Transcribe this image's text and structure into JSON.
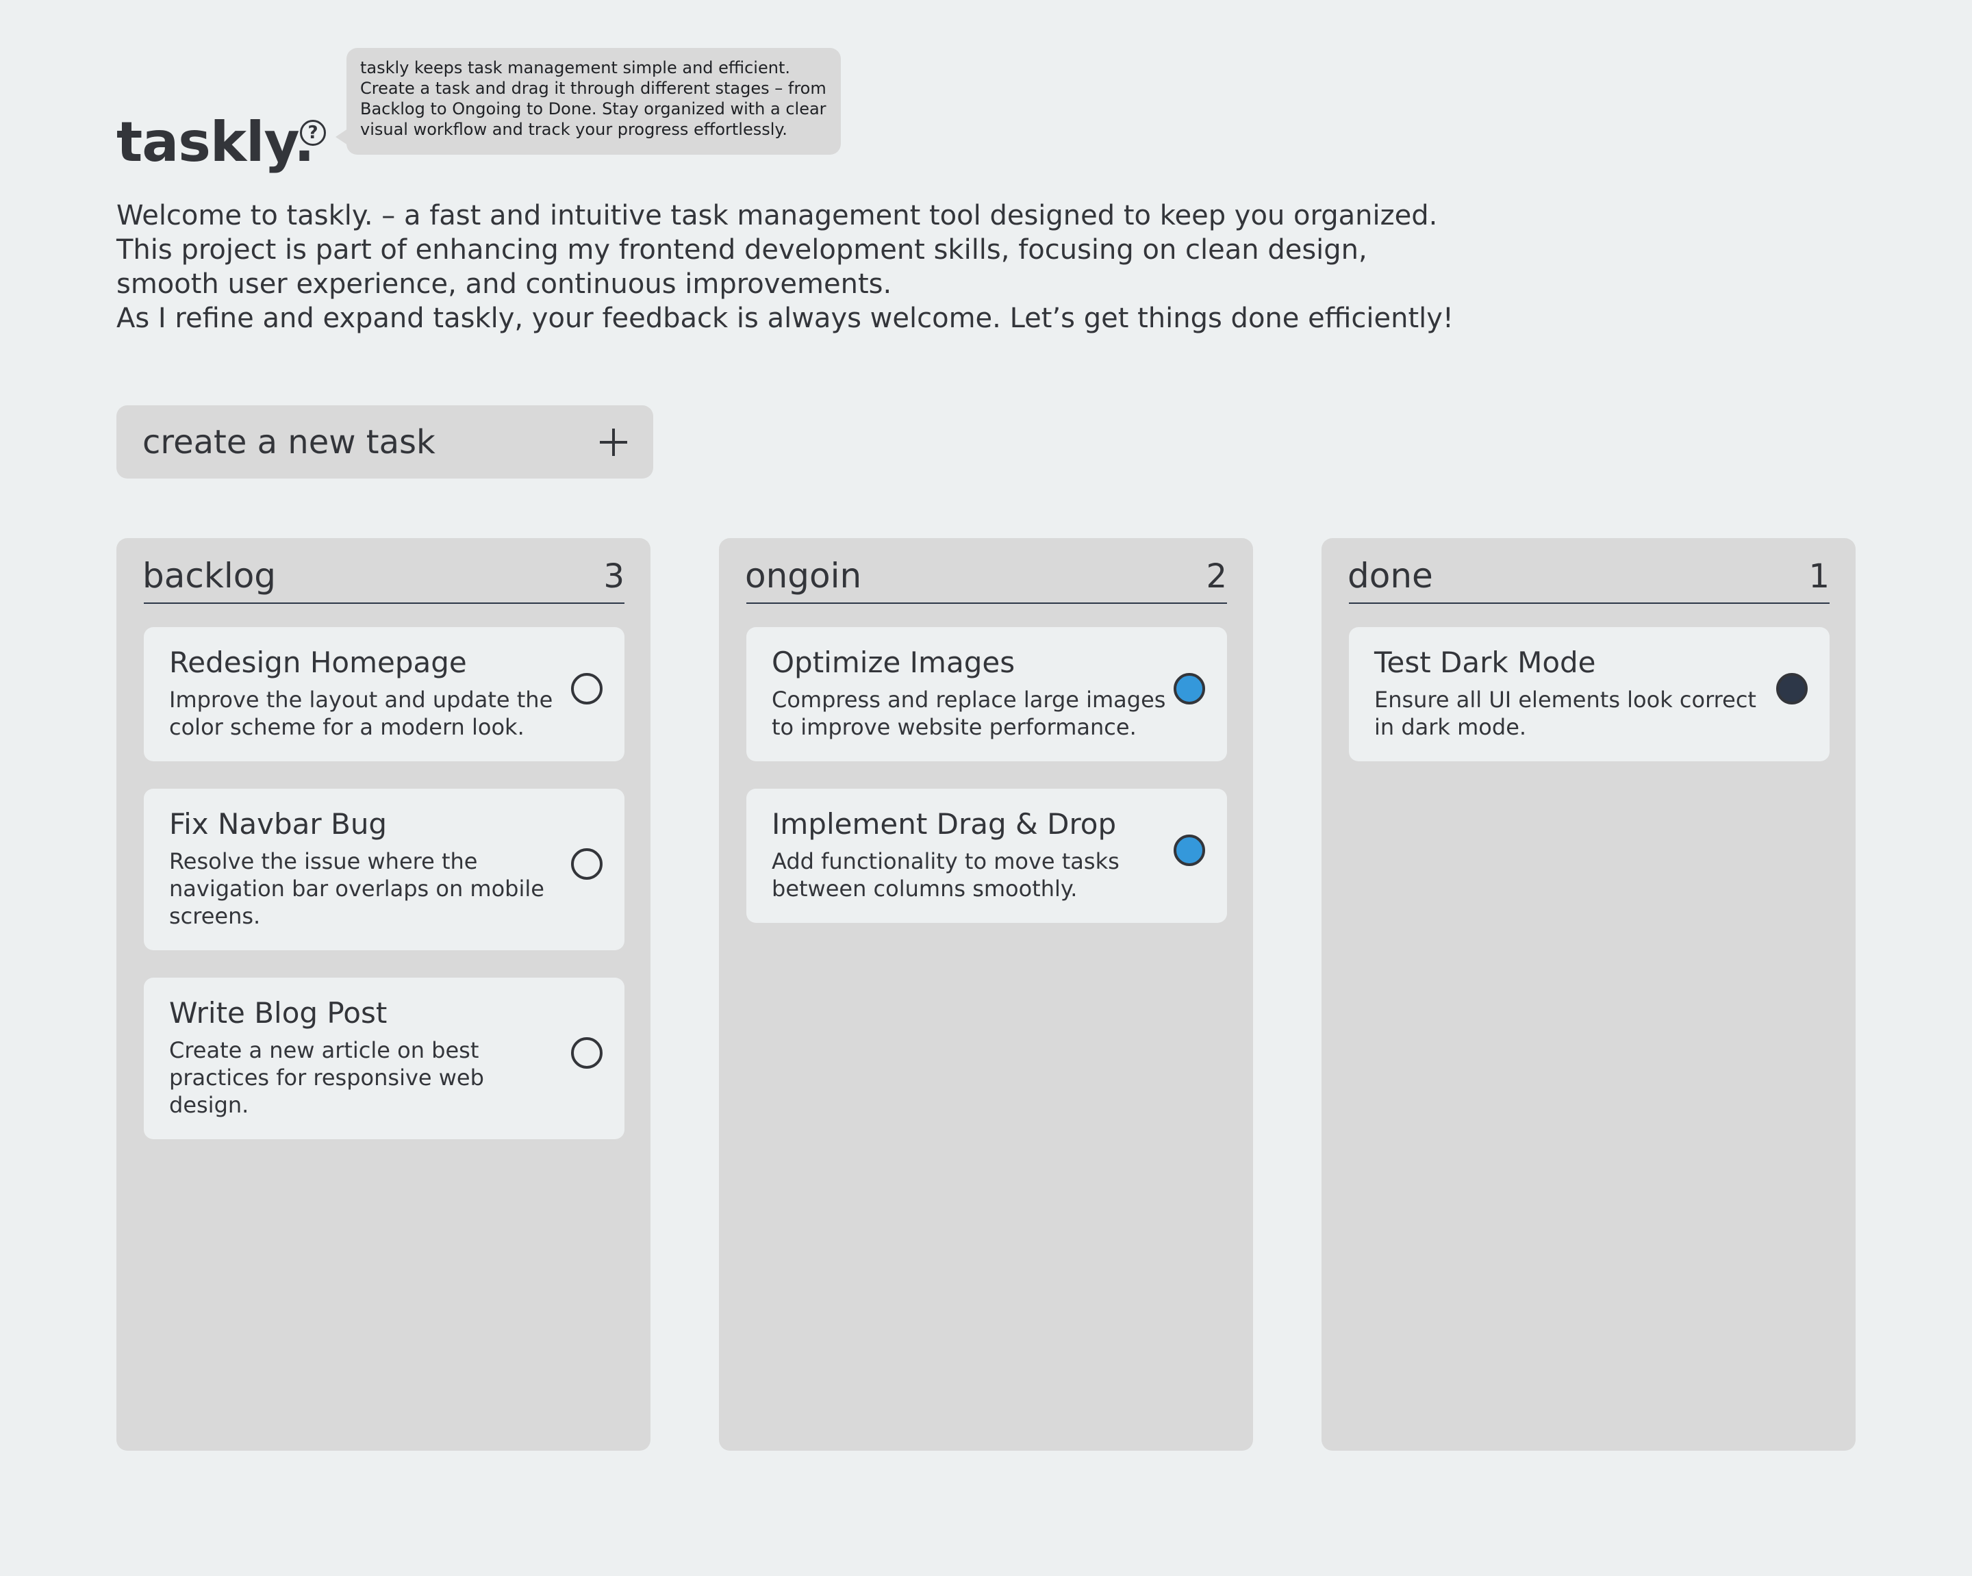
{
  "header": {
    "brand": "taskly.",
    "help_icon": "question-circle-icon",
    "tooltip_lines": [
      "taskly keeps task management simple and efficient.",
      "Create a task and drag it through different stages – from",
      "Backlog to Ongoing to Done. Stay organized with a clear",
      "visual workflow and track your progress effortlessly."
    ]
  },
  "intro": {
    "lines": [
      "Welcome to taskly. – a fast and intuitive task management tool designed to keep you organized.",
      "This project is part of enhancing my frontend development skills, focusing on clean design,",
      "smooth user experience, and continuous improvements.",
      "As I refine and expand taskly, your feedback is always welcome. Let’s get things done efficiently!"
    ]
  },
  "new_task": {
    "label": "create a new task",
    "icon": "plus-icon"
  },
  "colors": {
    "background": "#edf0f1",
    "panel": "#d9d9d9",
    "text": "#33353a",
    "divider": "#2d3748",
    "ongoing_dot": "#3498db",
    "done_dot": "#2d3748"
  },
  "columns": [
    {
      "title": "backlog",
      "count": "3",
      "tasks": [
        {
          "title": "Redesign Homepage",
          "desc": "Improve the layout and update the color scheme for a modern look.",
          "status": "backlog"
        },
        {
          "title": "Fix Navbar Bug",
          "desc": "Resolve the issue where the navigation bar overlaps on mobile screens.",
          "status": "backlog"
        },
        {
          "title": "Write Blog Post",
          "desc": "Create a new article on best practices for responsive web design.",
          "status": "backlog"
        }
      ]
    },
    {
      "title": "ongoin",
      "count": "2",
      "tasks": [
        {
          "title": "Optimize Images",
          "desc": "Compress and replace large images to improve website performance.",
          "status": "ongoing"
        },
        {
          "title": "Implement Drag & Drop",
          "desc": "Add functionality to move tasks between columns smoothly.",
          "status": "ongoing"
        }
      ]
    },
    {
      "title": "done",
      "count": "1",
      "tasks": [
        {
          "title": "Test Dark Mode",
          "desc": "Ensure all UI elements look correct in dark mode.",
          "status": "done"
        }
      ]
    }
  ]
}
